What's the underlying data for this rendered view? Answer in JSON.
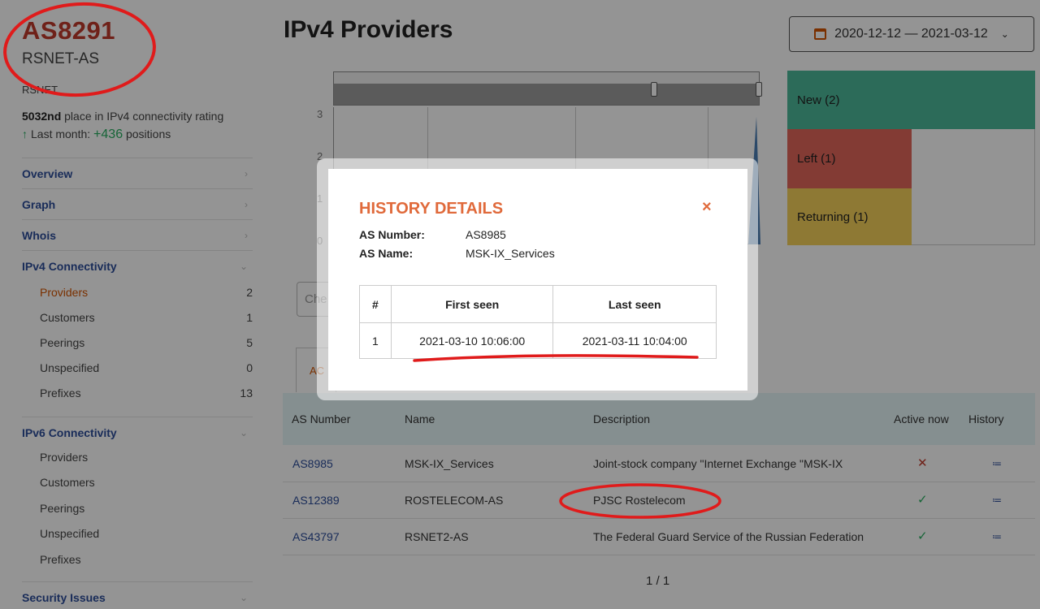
{
  "sidebar": {
    "as_number": "AS8291",
    "as_name": "RSNET-AS",
    "org": "RSNET",
    "rating_place": "5032nd",
    "rating_text": "place in IPv4 connectivity rating",
    "last_month_label": "Last month:",
    "last_month_delta": "+436",
    "last_month_suffix": "positions",
    "nav": {
      "overview": "Overview",
      "graph": "Graph",
      "whois": "Whois",
      "ipv4": "IPv4 Connectivity",
      "ipv6": "IPv6 Connectivity",
      "security": "Security Issues"
    },
    "ipv4_items": [
      {
        "label": "Providers",
        "count": "2"
      },
      {
        "label": "Customers",
        "count": "1"
      },
      {
        "label": "Peerings",
        "count": "5"
      },
      {
        "label": "Unspecified",
        "count": "0"
      },
      {
        "label": "Prefixes",
        "count": "13"
      }
    ],
    "ipv6_items": [
      {
        "label": "Providers"
      },
      {
        "label": "Customers"
      },
      {
        "label": "Peerings"
      },
      {
        "label": "Unspecified"
      },
      {
        "label": "Prefixes"
      }
    ]
  },
  "header": {
    "title": "IPv4 Providers",
    "date_range": "2020-12-12 — 2021-03-12"
  },
  "chart": {
    "y_ticks": [
      "3",
      "2",
      "1",
      "0"
    ]
  },
  "legend": {
    "new": "New (2)",
    "left": "Left (1)",
    "returning": "Returning (1)"
  },
  "filter": {
    "placeholder": "Che"
  },
  "tabs": {
    "active": "AC"
  },
  "table": {
    "headers": [
      "AS Number",
      "Name",
      "Description",
      "Active now",
      "History"
    ],
    "rows": [
      {
        "as": "AS8985",
        "name": "MSK-IX_Services",
        "desc": "Joint-stock company \"Internet Exchange \"MSK-IX",
        "active": "✕"
      },
      {
        "as": "AS12389",
        "name": "ROSTELECOM-AS",
        "desc": "PJSC Rostelecom",
        "active": "✓"
      },
      {
        "as": "AS43797",
        "name": "RSNET2-AS",
        "desc": "The Federal Guard Service of the Russian Federation",
        "active": "✓"
      }
    ],
    "history_icon": "≔",
    "pager": "1 / 1"
  },
  "modal": {
    "title": "HISTORY DETAILS",
    "close": "×",
    "as_number_label": "AS Number:",
    "as_number_value": "AS8985",
    "as_name_label": "AS Name:",
    "as_name_value": "MSK-IX_Services",
    "table_headers": [
      "#",
      "First seen",
      "Last seen"
    ],
    "rows": [
      {
        "n": "1",
        "first": "2021-03-10 10:06:00",
        "last": "2021-03-11 10:04:00"
      }
    ]
  },
  "colors": {
    "accent": "#d35400",
    "link": "#2c4d9a",
    "new": "#4db89a",
    "left": "#e2665a",
    "returning": "#f4d05a"
  }
}
